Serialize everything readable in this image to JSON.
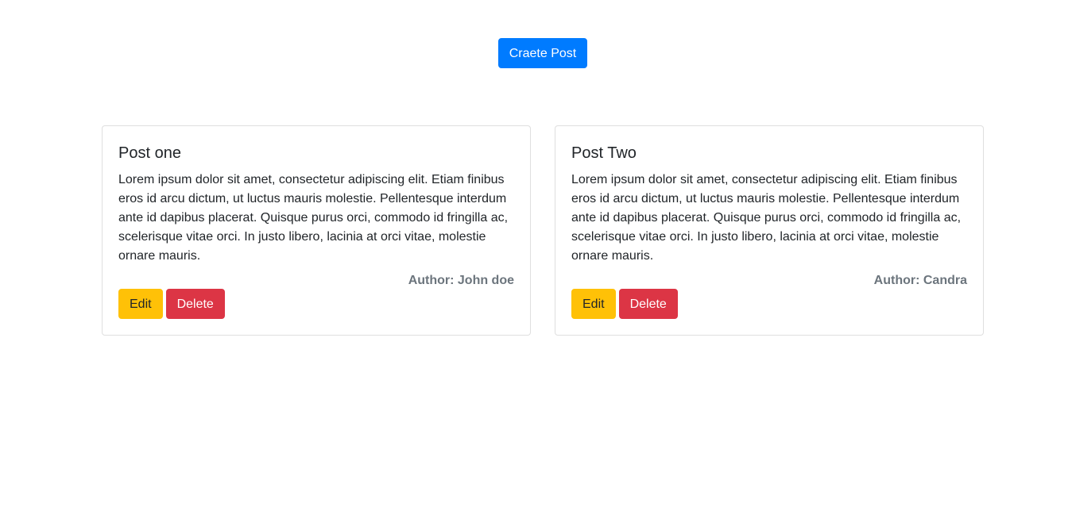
{
  "header": {
    "create_button_label": "Craete Post"
  },
  "posts": [
    {
      "title": "Post one",
      "body": "Lorem ipsum dolor sit amet, consectetur adipiscing elit. Etiam finibus eros id arcu dictum, ut luctus mauris molestie. Pellentesque interdum ante id dapibus placerat. Quisque purus orci, commodo id fringilla ac, scelerisque vitae orci. In justo libero, lacinia at orci vitae, molestie ornare mauris.",
      "author": "Author: John doe",
      "edit_label": "Edit",
      "delete_label": "Delete"
    },
    {
      "title": "Post Two",
      "body": "Lorem ipsum dolor sit amet, consectetur adipiscing elit. Etiam finibus eros id arcu dictum, ut luctus mauris molestie. Pellentesque interdum ante id dapibus placerat. Quisque purus orci, commodo id fringilla ac, scelerisque vitae orci. In justo libero, lacinia at orci vitae, molestie ornare mauris.",
      "author": "Author: Candra",
      "edit_label": "Edit",
      "delete_label": "Delete"
    }
  ],
  "colors": {
    "primary": "#007bff",
    "warning": "#ffc107",
    "danger": "#dc3545",
    "muted": "#6c757d"
  }
}
